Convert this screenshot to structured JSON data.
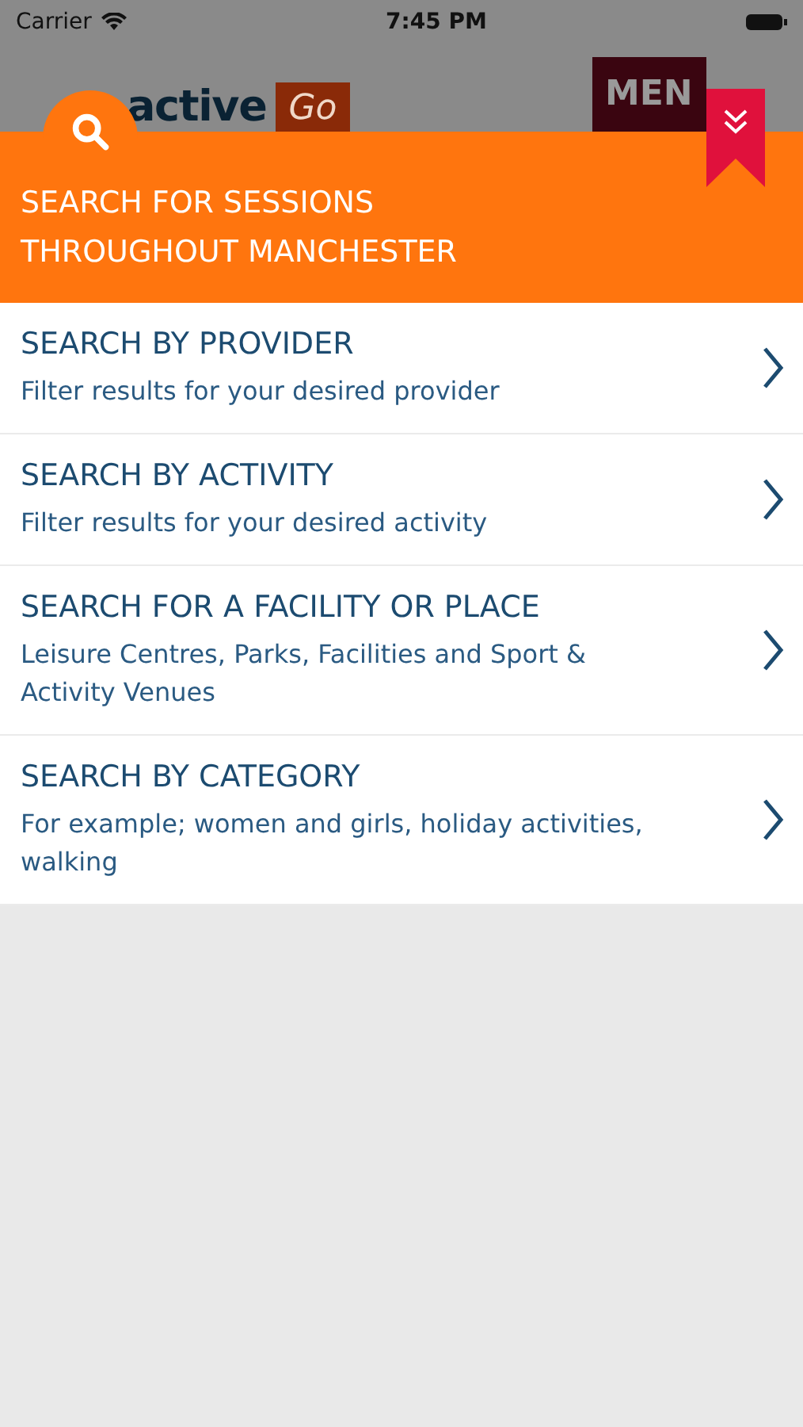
{
  "status_bar": {
    "carrier": "Carrier",
    "time": "7:45 PM"
  },
  "header": {
    "logo_text": "active",
    "logo_badge": "Go",
    "menu_button": "MEN"
  },
  "banner": {
    "title_lines": [
      "SEARCH FOR SESSIONS",
      "THROUGHOUT MANCHESTER"
    ]
  },
  "options": [
    {
      "title": "SEARCH BY PROVIDER",
      "subtitle": "Filter results for your desired provider"
    },
    {
      "title": "SEARCH BY ACTIVITY",
      "subtitle": "Filter results for your desired activity"
    },
    {
      "title": "SEARCH FOR A FACILITY OR PLACE",
      "subtitle": "Leisure Centres, Parks, Facilities and Sport & Activity Venues"
    },
    {
      "title": "SEARCH BY CATEGORY",
      "subtitle": "For example; women and girls, holiday activities, walking"
    }
  ]
}
